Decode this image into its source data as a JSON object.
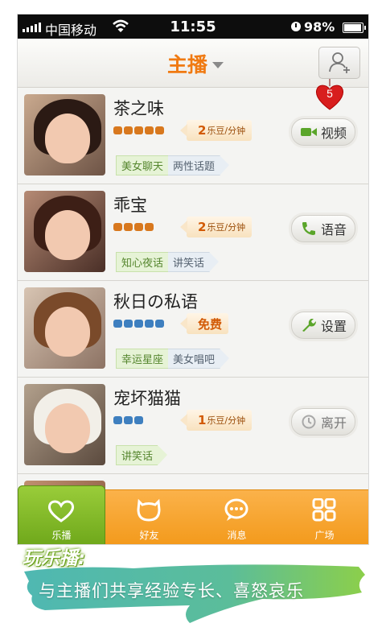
{
  "status_bar": {
    "carrier": "中国移动",
    "time": "11:55",
    "battery": "98%"
  },
  "nav": {
    "title": "主播"
  },
  "notification_badge": "5",
  "hosts": [
    {
      "name": "茶之味",
      "level_icons": 5,
      "level_color": "#d8781e",
      "price_value": "2",
      "price_unit": "乐豆/分钟",
      "tags": [
        "美女聊天",
        "两性话题"
      ],
      "status": "视频",
      "status_icon": "video-icon",
      "status_color": "#5aa52a"
    },
    {
      "name": "乖宝",
      "level_icons": 4,
      "level_color": "#d8781e",
      "price_value": "2",
      "price_unit": "乐豆/分钟",
      "tags": [
        "知心夜话",
        "讲笑话"
      ],
      "status": "语音",
      "status_icon": "phone-icon",
      "status_color": "#5aa52a"
    },
    {
      "name": "秋日の私语",
      "level_icons": 5,
      "level_color": "#3e7fbf",
      "price_value": "免费",
      "price_unit": "",
      "tags": [
        "幸运星座",
        "美女唱吧"
      ],
      "status": "设置",
      "status_icon": "wrench-icon",
      "status_color": "#5aa52a"
    },
    {
      "name": "宠坏猫猫",
      "level_icons": 3,
      "level_color": "#3e7fbf",
      "price_value": "1",
      "price_unit": "乐豆/分钟",
      "tags": [
        "讲笑话"
      ],
      "status": "离开",
      "status_icon": "clock-icon",
      "status_color": "#a8a8a8"
    }
  ],
  "tabs": [
    {
      "label": "乐播",
      "icon": "heart-icon",
      "active": true
    },
    {
      "label": "好友",
      "icon": "friends-icon",
      "active": false
    },
    {
      "label": "消息",
      "icon": "message-icon",
      "active": false
    },
    {
      "label": "广场",
      "icon": "grid-icon",
      "active": false
    }
  ],
  "banner": {
    "title": "玩乐播:",
    "subtitle": "与主播们共享经验专长、喜怒哀乐"
  },
  "colors": {
    "accent": "#f07a12",
    "tab_active": "#7cb526",
    "tab_bar": "#f5a22a"
  }
}
